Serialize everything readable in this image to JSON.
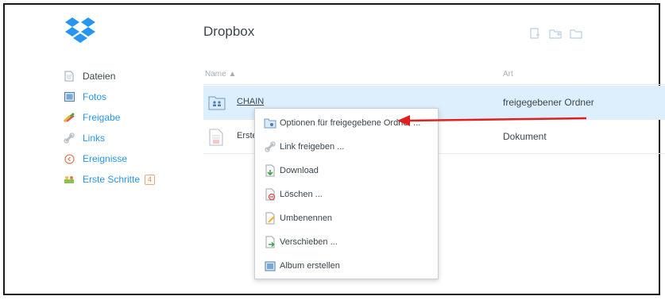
{
  "app": {
    "title": "Dropbox"
  },
  "sidebar": {
    "items": [
      {
        "label": "Dateien",
        "icon": "file-icon"
      },
      {
        "label": "Fotos",
        "icon": "photo-icon"
      },
      {
        "label": "Freigabe",
        "icon": "share-icon"
      },
      {
        "label": "Links",
        "icon": "link-icon"
      },
      {
        "label": "Ereignisse",
        "icon": "events-icon"
      },
      {
        "label": "Erste Schritte",
        "icon": "getting-started-icon",
        "badge": "4"
      }
    ]
  },
  "table": {
    "columns": {
      "name": "Name ▲",
      "type": "Art"
    },
    "rows": [
      {
        "name": "CHAIN",
        "type": "freigegebener Ordner",
        "icon": "shared-folder-icon",
        "selected": true
      },
      {
        "name": "Erste",
        "type": "Dokument",
        "icon": "document-icon",
        "selected": false
      }
    ]
  },
  "context_menu": {
    "items": [
      {
        "label": "Optionen für freigegebene Ordner ...",
        "icon": "folder-options-icon"
      },
      {
        "label": "Link freigeben ...",
        "icon": "link-icon"
      },
      {
        "label": "Download",
        "icon": "download-icon"
      },
      {
        "label": "Löschen ...",
        "icon": "delete-icon"
      },
      {
        "label": "Umbenennen",
        "icon": "rename-icon"
      },
      {
        "label": "Verschieben ...",
        "icon": "move-icon"
      },
      {
        "label": "Album erstellen",
        "icon": "album-icon"
      }
    ]
  },
  "colors": {
    "accent": "#2895f1",
    "selection": "#ddeefc",
    "annotation": "#e02020"
  }
}
